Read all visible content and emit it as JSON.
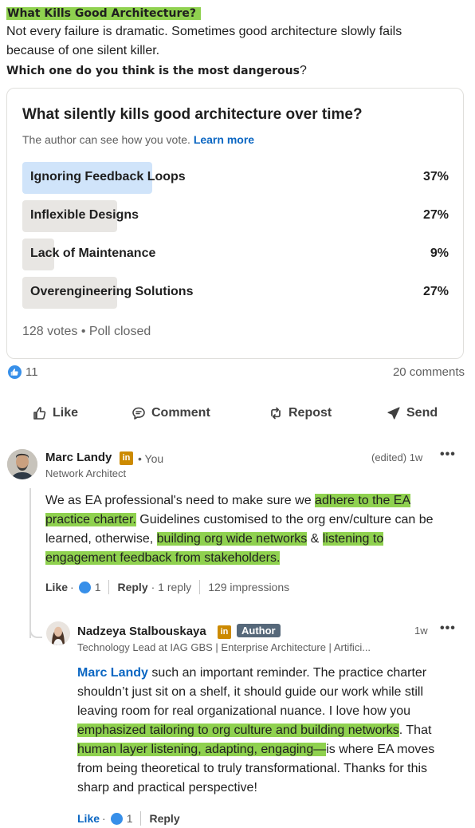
{
  "post": {
    "title": "What Kills Good Architecture",
    "title_mark": "?",
    "line1": "Not every failure is dramatic. Sometimes good architecture slowly fails",
    "line2": "because of one silent killer.",
    "question": "Which one do you think is the most dangerous",
    "question_mark": "?"
  },
  "poll": {
    "question": "What silently kills good architecture over time?",
    "note": "The author can see how you vote.",
    "learn_more": "Learn more",
    "options": [
      {
        "label": "Ignoring Feedback Loops",
        "percent_text": "37%",
        "percent": 37,
        "leading": true
      },
      {
        "label": "Inflexible Designs",
        "percent_text": "27%",
        "percent": 27,
        "leading": false
      },
      {
        "label": "Lack of Maintenance",
        "percent_text": "9%",
        "percent": 9,
        "leading": false
      },
      {
        "label": "Overengineering Solutions",
        "percent_text": "27%",
        "percent": 27,
        "leading": false
      }
    ],
    "footer": "128 votes • Poll closed"
  },
  "social": {
    "reactions": "11",
    "comments": "20 comments"
  },
  "actions": {
    "like": "Like",
    "comment": "Comment",
    "repost": "Repost",
    "send": "Send"
  },
  "comment1": {
    "name": "Marc Landy",
    "you": "• You",
    "headline": "Network Architect",
    "time": "(edited) 1w",
    "body": {
      "p1": "We as EA professional's need to make sure we ",
      "h1": "adhere to the EA",
      "h1b": "practice charter.",
      "p2": " Guidelines customised to the org env/culture can be",
      "p3": "learned, otherwise, ",
      "h2": "building org wide networks",
      "p4": " & ",
      "h3": "listening to",
      "h3b": "engagement feedback from stakeholders."
    },
    "like": "Like",
    "like_count": "1",
    "reply": "Reply",
    "reply_count": "· 1 reply",
    "impressions": "129 impressions"
  },
  "comment2": {
    "name": "Nadzeya Stalbouskaya",
    "badge": "Author",
    "headline": "Technology Lead at IAG GBS | Enterprise Architecture | Artifici...",
    "time": "1w",
    "body": {
      "mention": "Marc Landy",
      "l1": " such an important reminder. The practice charter",
      "l2": "shouldn’t just sit on a shelf, it should guide our work while still",
      "l3": "leaving room for real organizational nuance. I love how you",
      "h1": "emphasized tailoring to org culture and building networks",
      "l4": ". That",
      "h2": "human layer listening, adapting, engaging—",
      "l5": "is where EA moves",
      "l6": "from being theoretical to truly transformational. Thanks for this",
      "l7": "sharp and practical perspective!"
    },
    "like": "Like",
    "like_count": "1",
    "reply": "Reply"
  }
}
